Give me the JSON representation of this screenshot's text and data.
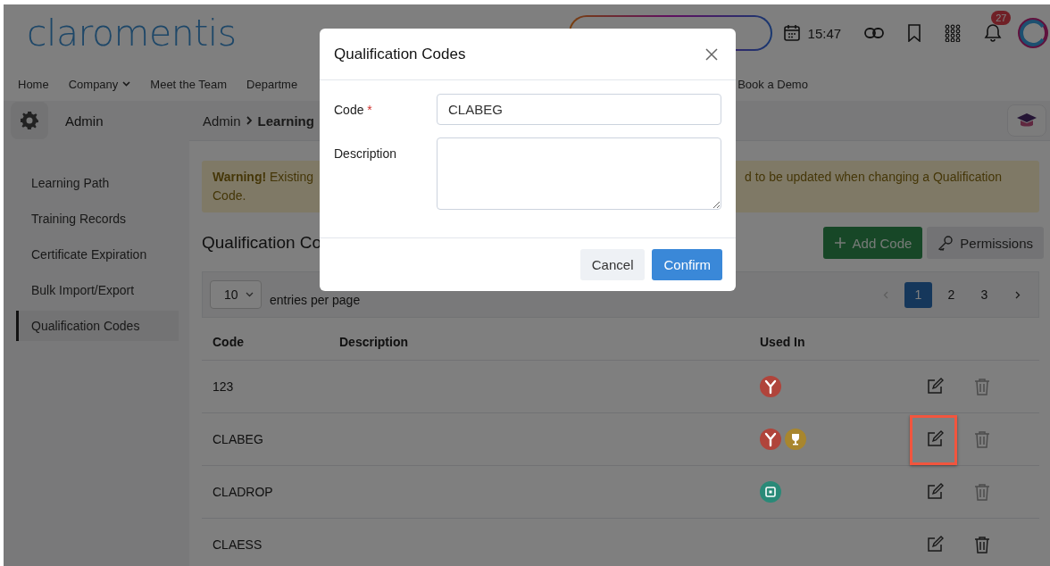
{
  "header": {
    "logo": "claromentis",
    "time": "15:47",
    "notification_count": "27"
  },
  "nav": [
    "Home",
    "Company",
    "Meet the Team",
    "Departme",
    "Book a Demo"
  ],
  "sidebar": {
    "title": "Admin",
    "items": [
      {
        "label": "Learning Path",
        "selected": false
      },
      {
        "label": "Training Records",
        "selected": false
      },
      {
        "label": "Certificate Expiration",
        "selected": false
      },
      {
        "label": "Bulk Import/Export",
        "selected": false
      },
      {
        "label": "Qualification Codes",
        "selected": true
      }
    ]
  },
  "breadcrumb": {
    "parent": "Admin",
    "current": "Learning"
  },
  "warning": {
    "lead": "**Warning!** Existing",
    "tail": "d to be updated when changing a Qualification",
    "line2": "Code."
  },
  "page_title": "Qualification Co",
  "buttons": {
    "add": "Add Code",
    "permissions": "Permissions"
  },
  "table": {
    "page_size": "10",
    "page_size_label": "entries per page",
    "pages": [
      {
        "label": "1",
        "selected": true
      },
      {
        "label": "2",
        "selected": false
      },
      {
        "label": "3",
        "selected": false
      }
    ],
    "columns": [
      "Code",
      "Description",
      "Used In"
    ],
    "rows": [
      {
        "code": "123",
        "used_in": [
          {
            "kind": "path",
            "color": "#b0443b"
          }
        ],
        "highlighted": false,
        "delete_disabled": true
      },
      {
        "code": "CLABEG",
        "used_in": [
          {
            "kind": "path",
            "color": "#b0443b"
          },
          {
            "kind": "trophy",
            "color": "#a8862e"
          }
        ],
        "highlighted": true,
        "delete_disabled": true
      },
      {
        "code": "CLADROP",
        "used_in": [
          {
            "kind": "calendar",
            "color": "#2a8a78"
          }
        ],
        "highlighted": false,
        "delete_disabled": true
      },
      {
        "code": "CLAESS",
        "used_in": [],
        "highlighted": false,
        "delete_disabled": false
      }
    ]
  },
  "modal": {
    "title": "Qualification Codes",
    "code_label": "Code",
    "required_mark": "*",
    "code_value": "CLABEG",
    "description_label": "Description",
    "cancel": "Cancel",
    "confirm": "Confirm"
  }
}
